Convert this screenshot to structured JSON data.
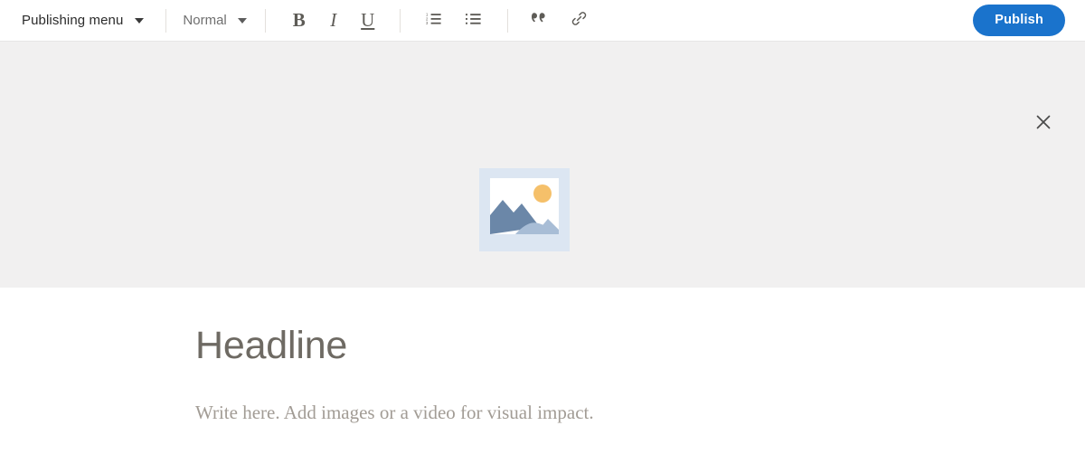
{
  "toolbar": {
    "publishing_menu": {
      "label": "Publishing menu",
      "caret_icon": "chevron-down-icon"
    },
    "paragraph_style": {
      "label": "Normal",
      "caret_icon": "chevron-down-icon"
    },
    "format_buttons": [
      {
        "name": "bold",
        "glyph": "B"
      },
      {
        "name": "italic",
        "glyph": "I"
      },
      {
        "name": "underline",
        "glyph": "U"
      }
    ],
    "list_buttons": [
      {
        "name": "numbered-list-icon"
      },
      {
        "name": "bulleted-list-icon"
      }
    ],
    "insert_buttons": [
      {
        "name": "blockquote-icon"
      },
      {
        "name": "link-icon"
      }
    ],
    "publish": {
      "label": "Publish",
      "color": "#1a73cc",
      "text_color": "#ffffff"
    }
  },
  "hero": {
    "background_color": "#f1f0f0",
    "close_icon": "close-icon",
    "image_placeholder": {
      "name": "image-placeholder-icon",
      "frame_color": "#dce6f2",
      "inner_color": "#ffffff",
      "mountain_color": "#6b87a8",
      "hill_color": "#a8bdd6",
      "sun_color": "#f5c06a"
    }
  },
  "article": {
    "headline": "Headline",
    "headline_color": "#6e6a63",
    "body_placeholder": "Write here. Add images or a video for visual impact.",
    "body_color": "#a29c95"
  }
}
